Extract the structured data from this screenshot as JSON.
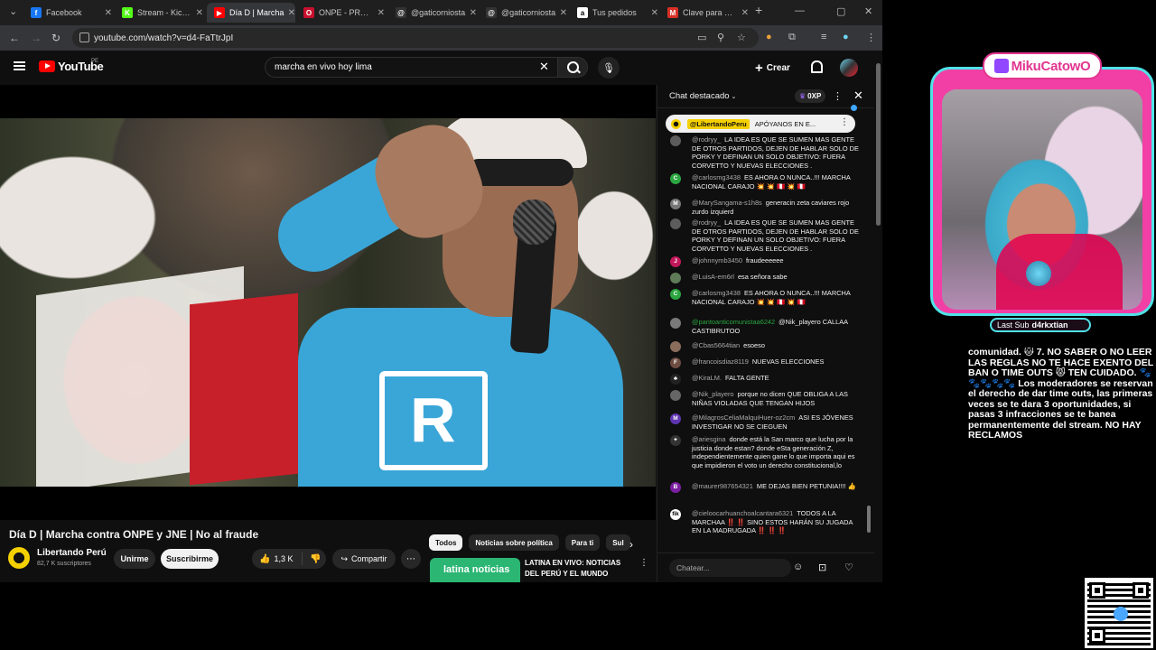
{
  "browser": {
    "tabs": [
      {
        "label": "Facebook",
        "color": "#1877f2",
        "glyph": "f"
      },
      {
        "label": "Stream - Kick Dashboard",
        "color": "#53fc18",
        "glyph": "K"
      },
      {
        "label": "Día D | Marcha",
        "color": "#ff0000",
        "glyph": "▶",
        "active": true
      },
      {
        "label": "ONPE - PRESENTACIÓN",
        "color": "#c8102e",
        "glyph": "O"
      },
      {
        "label": "@gaticorniosta",
        "color": "#333333",
        "glyph": "@"
      },
      {
        "label": "@gaticorniosta",
        "color": "#333333",
        "glyph": "@"
      },
      {
        "label": "Tus pedidos",
        "color": "#ffffff",
        "glyph": "a"
      },
      {
        "label": "Clave para Com",
        "color": "#d93025",
        "glyph": "M"
      }
    ],
    "url": "youtube.com/watch?v=d4-FaTtrJpI"
  },
  "youtube": {
    "wordmark": "YouTube",
    "country": "PE",
    "search_value": "marcha en vivo hoy lima",
    "create_label": "Crear",
    "video_title": "Día D | Marcha contra ONPE y JNE | No al fraude",
    "channel_name": "Libertando Perú",
    "subscribers": "82,7 K suscriptores",
    "join_label": "Unirme",
    "subscribe_label": "Suscribirme",
    "like_count": "1,3 K",
    "share_label": "Compartir",
    "chips": [
      "Todos",
      "Noticias sobre política",
      "Para ti",
      "Sul"
    ],
    "rec_thumb_text": "latina noticias",
    "rec_title": "LATINA EN VIVO: NOTICIAS DEL PERÚ Y EL MUNDO"
  },
  "chat": {
    "mode": "Chat destacado",
    "xp": "0XP",
    "pinned_user": "@LibertandoPeru",
    "pinned_text": "APÓYANOS EN E...",
    "input_placeholder": "Chatear...",
    "messages": [
      {
        "user": "@rodryy_",
        "text": "LA IDEA ES QUE SE SUMEN MAS GENTE DE OTROS PARTIDOS, DEJEN DE HABLAR SOLO DE PORKY Y DEFINAN UN SOLO OBJETIVO: FUERA CORVETTO Y NUEVAS ELECCIONES .",
        "color": "#5c5c5c",
        "initial": ""
      },
      {
        "user": "@carlosmg3438",
        "text": "ES AHORA O NUNCA..!!! MARCHA NACIONAL CARAJO 💥 💥 🇵🇪 💥 🇵🇪",
        "color": "#2ba640",
        "initial": "C"
      },
      {
        "user": "@MarySangama-s1h8s",
        "text": "generacin zeta caviares rojo zurdo izquierd",
        "color": "#777777",
        "initial": "M"
      },
      {
        "user": "@rodryy_",
        "text": "LA IDEA ES QUE SE SUMEN MAS GENTE DE OTROS PARTIDOS, DEJEN DE HABLAR SOLO DE PORKY Y DEFINAN UN SOLO OBJETIVO: FUERA CORVETTO Y NUEVAS ELECCIONES .",
        "color": "#5c5c5c",
        "initial": ""
      },
      {
        "user": "@johnnymb3450",
        "text": "fraudeeeeee",
        "color": "#c2185b",
        "initial": "J"
      },
      {
        "user": "@LuisA-em6rl",
        "text": "esa señora sabe",
        "color": "#5f7c58",
        "initial": ""
      },
      {
        "user": "@carlosmg3438",
        "text": "ES AHORA O NUNCA..!!! MARCHA NACIONAL CARAJO 💥 💥 🇵🇪 💥 🇵🇪",
        "color": "#2ba640",
        "initial": "C"
      },
      {
        "user": "@pantoanticomunistaa6242",
        "text": "@Nik_playero CALLAA CASTIBRUTOO",
        "color": "#7a7a7a",
        "initial": "",
        "green": true
      },
      {
        "user": "@Cbas5664tian",
        "text": "esoeso",
        "color": "#8a6d5b",
        "initial": ""
      },
      {
        "user": "@francoisdiaz8119",
        "text": "NUEVAS ELECCIONES",
        "color": "#6d4c41",
        "initial": "F"
      },
      {
        "user": "@KiraLM.",
        "text": "FALTA GENTE",
        "color": "#222222",
        "initial": "♣"
      },
      {
        "user": "@Nik_playero",
        "text": "porque no dicen QUE OBLIGA A LAS NIÑAS VIOLADAS QUE TENGAN HIJOS",
        "color": "#666666",
        "initial": ""
      },
      {
        "user": "@MilagrosCeliaMalquiHuer-oz2cm",
        "text": "ASI ES JÓVENES INVESTIGAR NO SE CIEGUEN",
        "color": "#5e35b1",
        "initial": "M"
      },
      {
        "user": "@ariesgina",
        "text": "donde está la San marco que lucha por la justicia donde estan? donde eSta generación Z, independientemente quien gane lo que importa aqui es que impidieron el voto un derecho constitucional,lo",
        "color": "#333333",
        "initial": "✦"
      },
      {
        "user": "@maurer987654321",
        "text": "ME DEJAS BIEN PETUNIA!!!! 👍",
        "color": "#7b1fa2",
        "initial": "B"
      },
      {
        "user": "@cieloocarhuanchoalcantara6321",
        "text": "TODOS A LA MARCHAA ‼️ ‼️ SINO ESTOS HARÁN SU JUGADA EN LA MADRUGADA ‼️ ‼️ ‼️",
        "color": "#ffffff",
        "initial": "fik"
      }
    ]
  },
  "overlay": {
    "title": "MikuCatowO",
    "last_sub_label": "Last Sub",
    "last_sub_value": "d4rkxtian",
    "rules_text": "comunidad. 🐱 7. NO SABER O NO LEER LAS REGLAS NO TE HACE EXENTO DEL BAN O TIME OUTS 😾 TEN CUIDADO. 🐾🐾🐾🐾🐾 Los moderadores se reservan el derecho de dar time outs, las primeras veces se te dara 3 oportunidades, si pasas 3 infracciones se te banea permanentemente del stream. NO HAY RECLAMOS"
  },
  "colors": {
    "youtube_red": "#ff0000",
    "overlay_pink": "#f23fa6",
    "overlay_cyan": "#50e3e8"
  }
}
